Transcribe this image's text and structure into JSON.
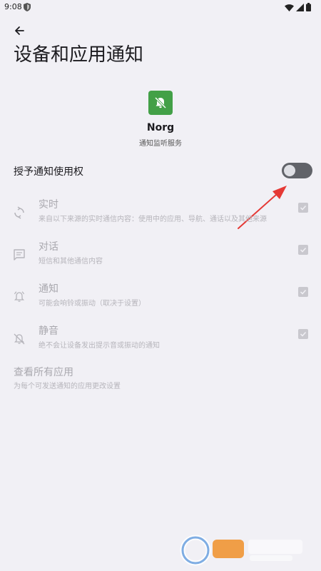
{
  "status_bar": {
    "time": "9:08"
  },
  "header": {
    "title": "设备和应用通知"
  },
  "app": {
    "name": "Norg",
    "subtitle": "通知监听服务"
  },
  "grant": {
    "label": "授予通知使用权",
    "enabled": false
  },
  "permissions": [
    {
      "title": "实时",
      "subtitle": "来自以下来源的实时通信内容：使用中的应用、导航、通话以及其他来源",
      "icon": "sync-icon",
      "checked": true
    },
    {
      "title": "对话",
      "subtitle": "短信和其他通信内容",
      "icon": "message-icon",
      "checked": true
    },
    {
      "title": "通知",
      "subtitle": "可能会响铃或振动（取决于设置）",
      "icon": "bell-icon",
      "checked": true
    },
    {
      "title": "静音",
      "subtitle": "绝不会让设备发出提示音或振动的通知",
      "icon": "bell-off-icon",
      "checked": true
    }
  ],
  "view_all": {
    "title": "查看所有应用",
    "subtitle": "为每个可发送通知的应用更改设置"
  },
  "colors": {
    "background": "#f1f0f5",
    "app_icon": "#43a047",
    "toggle_track": "#616369",
    "arrow": "#e53935"
  }
}
